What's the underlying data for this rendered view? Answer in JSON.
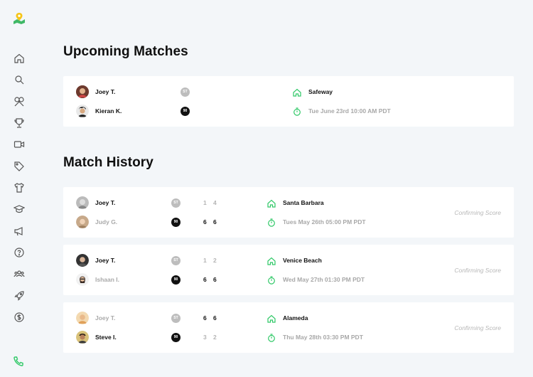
{
  "sidebar": {
    "logo_icon": "map-pin-logo-icon",
    "items": [
      {
        "icon": "home-icon"
      },
      {
        "icon": "search-icon"
      },
      {
        "icon": "rackets-icon"
      },
      {
        "icon": "trophy-icon"
      },
      {
        "icon": "video-icon"
      },
      {
        "icon": "tag-icon"
      },
      {
        "icon": "shirt-icon"
      },
      {
        "icon": "graduation-cap-icon"
      },
      {
        "icon": "megaphone-icon"
      },
      {
        "icon": "help-icon"
      },
      {
        "icon": "group-icon"
      },
      {
        "icon": "rocket-icon"
      },
      {
        "icon": "dollar-icon"
      }
    ],
    "phone_icon": "phone-icon",
    "accent": "#2ec866"
  },
  "upcoming": {
    "title": "Upcoming Matches",
    "match": {
      "player1": {
        "name": "Joey T.",
        "badge": "ST"
      },
      "player2": {
        "name": "Kieran K.",
        "badge": "90"
      },
      "location": "Safeway",
      "time": "Tue June 23rd 10:00 AM  PDT"
    }
  },
  "history": {
    "title": "Match History",
    "matches": [
      {
        "player1": {
          "name": "Joey T.",
          "badge": "ST",
          "s1": "1",
          "s2": "4"
        },
        "player2": {
          "name": "Judy G.",
          "badge": "90",
          "s1": "6",
          "s2": "6"
        },
        "location": "Santa Barbara",
        "time": "Tues May 26th 05:00 PM  PDT",
        "status": "Confirming Score"
      },
      {
        "player1": {
          "name": "Joey T.",
          "badge": "ST",
          "s1": "1",
          "s2": "2"
        },
        "player2": {
          "name": "Ishaan I.",
          "badge": "90",
          "s1": "6",
          "s2": "6"
        },
        "location": "Venice Beach",
        "time": "Wed May 27th 01:30 PM  PDT",
        "status": "Confirming Score"
      },
      {
        "player1": {
          "name": "Joey T.",
          "badge": "ST",
          "s1": "6",
          "s2": "6"
        },
        "player2": {
          "name": "Steve I.",
          "badge": "90",
          "s1": "3",
          "s2": "2"
        },
        "location": "Alameda",
        "time": "Thu May 28th 03:30 PM  PDT",
        "status": "Confirming Score"
      }
    ]
  }
}
